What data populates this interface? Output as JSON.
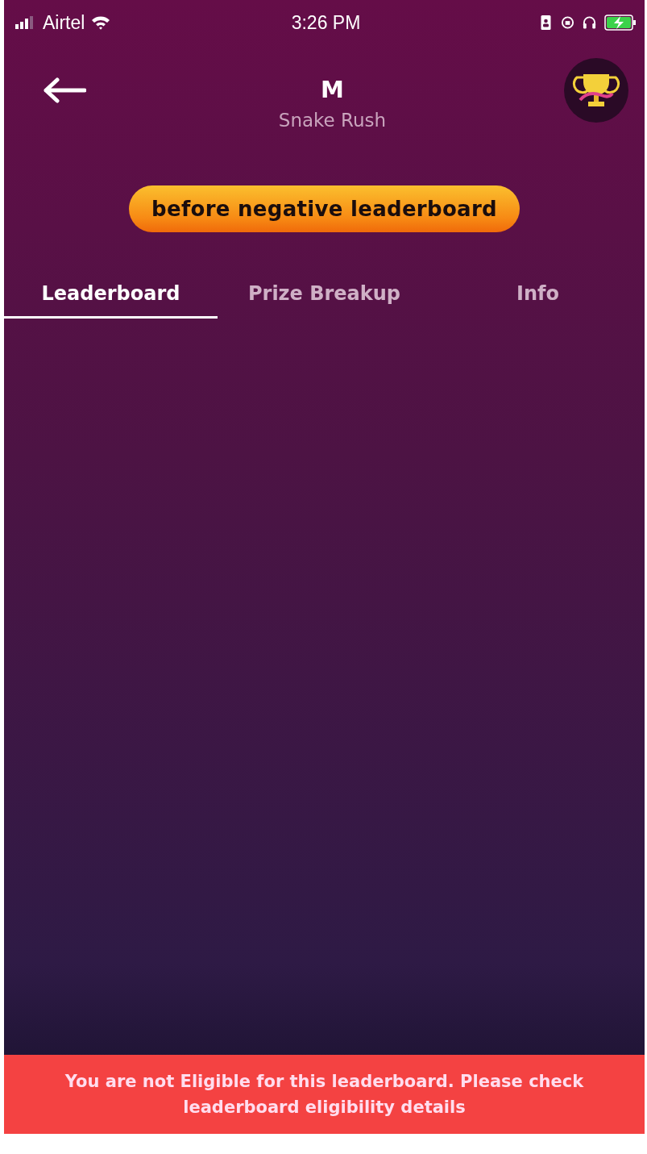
{
  "status_bar": {
    "carrier": "Airtel",
    "time": "3:26 PM"
  },
  "header": {
    "title": "M",
    "subtitle": "Snake Rush"
  },
  "badge": {
    "label": "before negative leaderboard"
  },
  "tabs": [
    {
      "label": "Leaderboard",
      "selected": true
    },
    {
      "label": "Prize Breakup",
      "selected": false
    },
    {
      "label": "Info",
      "selected": false
    }
  ],
  "notice": {
    "message": "You are not Eligible for this leaderboard. Please check leaderboard eligibility details"
  }
}
